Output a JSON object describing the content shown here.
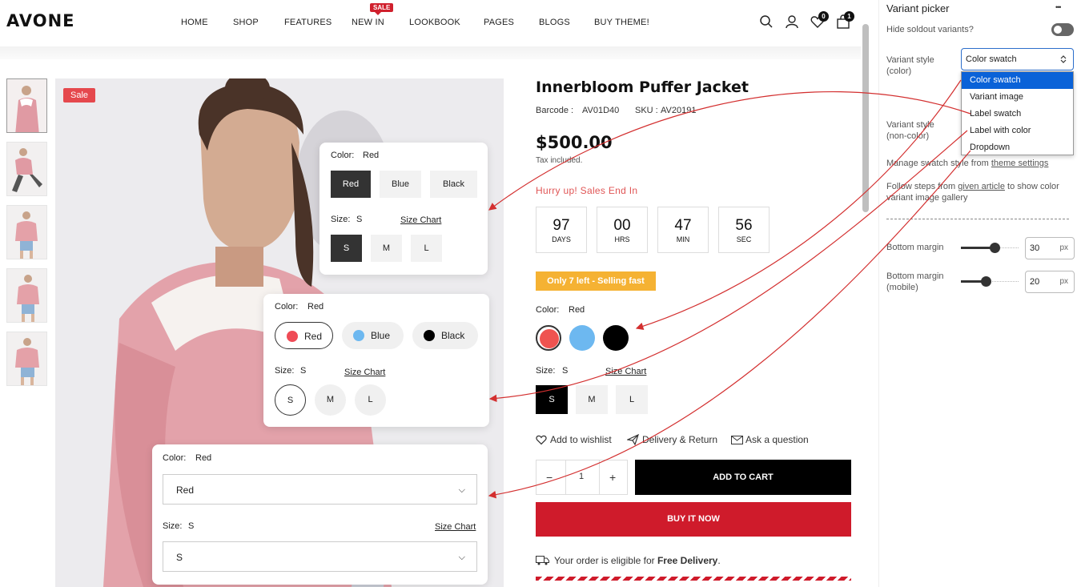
{
  "header": {
    "logo": "AVONE",
    "nav": [
      "HOME",
      "SHOP",
      "FEATURES",
      "NEW IN",
      "LOOKBOOK",
      "PAGES",
      "BLOGS",
      "BUY THEME!"
    ],
    "new_in_tag": "SALE",
    "wishlist_count": "0",
    "cart_count": "1"
  },
  "gallery": {
    "sale_badge": "Sale"
  },
  "product": {
    "title": "Innerbloom Puffer Jacket",
    "barcode_label": "Barcode :",
    "barcode": "AV01D40",
    "sku_label": "SKU :",
    "sku": "AV20191",
    "price": "$500.00",
    "tax_note": "Tax included.",
    "hurry": "Hurry up! Sales End In",
    "countdown": [
      {
        "value": "97",
        "unit": "DAYS"
      },
      {
        "value": "00",
        "unit": "HRS"
      },
      {
        "value": "47",
        "unit": "MIN"
      },
      {
        "value": "56",
        "unit": "SEC"
      }
    ],
    "stock_badge": "Only 7 left - Selling fast",
    "color_label": "Color:",
    "color_value": "Red",
    "swatches": [
      {
        "name": "Red",
        "color": "#ef5350"
      },
      {
        "name": "Blue",
        "color": "#6db8f0"
      },
      {
        "name": "Black",
        "color": "#000000"
      }
    ],
    "size_label": "Size:",
    "size_value": "S",
    "size_chart": "Size Chart",
    "sizes": [
      "S",
      "M",
      "L"
    ],
    "actions": [
      "Add to wishlist",
      "Delivery & Return",
      "Ask a question"
    ],
    "qty": "1",
    "qty_minus": "−",
    "qty_plus": "+",
    "add_to_cart": "ADD TO CART",
    "buy_now": "BUY IT NOW",
    "delivery_prefix": "Your order is eligible for ",
    "delivery_bold": "Free Delivery",
    "delivery_suffix": "."
  },
  "card_label": {
    "color_label": "Color:",
    "color_value": "Red",
    "colors": [
      "Red",
      "Blue",
      "Black"
    ],
    "size_label": "Size:",
    "size_value": "S",
    "size_chart": "Size Chart",
    "sizes": [
      "S",
      "M",
      "L"
    ]
  },
  "card_label_color": {
    "color_label": "Color:",
    "color_value": "Red",
    "colors": [
      {
        "name": "Red",
        "color": "#ef4b56"
      },
      {
        "name": "Blue",
        "color": "#6db8f0"
      },
      {
        "name": "Black",
        "color": "#000000"
      }
    ],
    "size_label": "Size:",
    "size_value": "S",
    "size_chart": "Size Chart",
    "sizes": [
      "S",
      "M",
      "L"
    ]
  },
  "card_dropdown": {
    "color_label": "Color:",
    "color_value": "Red",
    "color_select": "Red",
    "size_label": "Size:",
    "size_value": "S",
    "size_chart": "Size Chart",
    "size_select": "S"
  },
  "panel": {
    "title": "Variant picker",
    "hide_soldout": "Hide soldout variants?",
    "variant_style_color": "Variant style (color)",
    "variant_style_color_value": "Color swatch",
    "options": [
      "Color swatch",
      "Variant image",
      "Label swatch",
      "Label with color",
      "Dropdown"
    ],
    "variant_style_noncolor": "Variant style (non-color)",
    "manage_prefix": "Manage swatch style from ",
    "manage_link": "theme settings",
    "follow_prefix": "Follow steps from ",
    "follow_link": "given article",
    "follow_suffix": " to show color variant image gallery",
    "bottom_margin": "Bottom margin",
    "bottom_margin_value": "30",
    "bottom_margin_mobile": "Bottom margin (mobile)",
    "bottom_margin_mobile_value": "20",
    "unit": "px",
    "more": "•••"
  }
}
